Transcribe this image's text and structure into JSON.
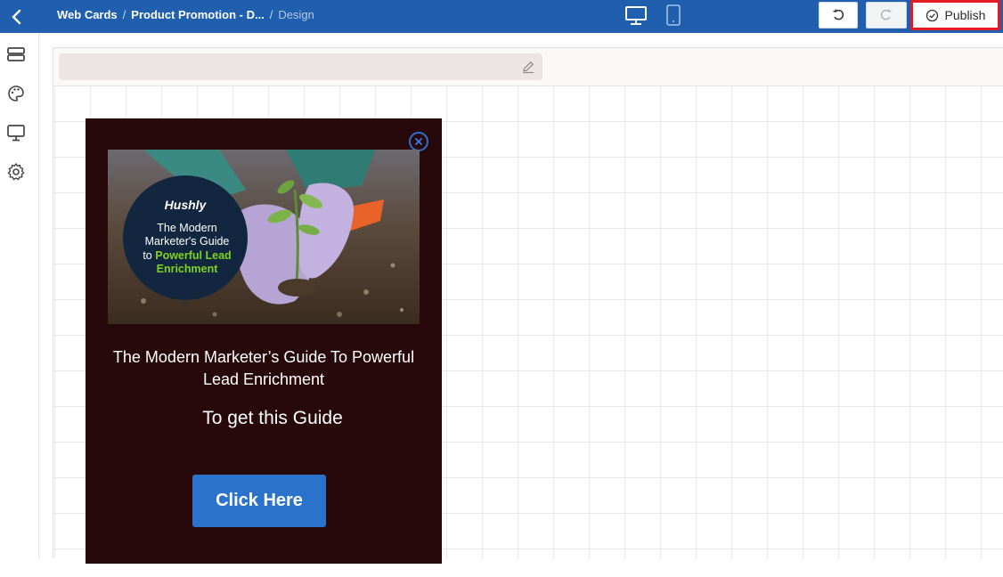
{
  "header": {
    "breadcrumb": [
      "Web Cards",
      "Product Promotion - D...",
      "Design"
    ],
    "publish_label": "Publish"
  },
  "sidebar": {
    "items": [
      "layout-icon",
      "palette-icon",
      "monitor-icon",
      "settings-icon"
    ]
  },
  "card": {
    "hero": {
      "brand": "Hushly",
      "line1": "The Modern",
      "line2": "Marketer's Guide",
      "line3_prefix": "to ",
      "line3_highlight": "Powerful Lead",
      "line4": "Enrichment"
    },
    "title_line1": "The Modern Marketer’s Guide To Powerful",
    "title_line2": "Lead Enrichment",
    "subtitle": "To get this Guide",
    "cta_label": "Click Here"
  },
  "colors": {
    "topbar": "#1f5fae",
    "card_bg": "#27090b",
    "cta": "#2b72cc",
    "highlight": "#7dd321",
    "publish_border": "#e31b23"
  }
}
